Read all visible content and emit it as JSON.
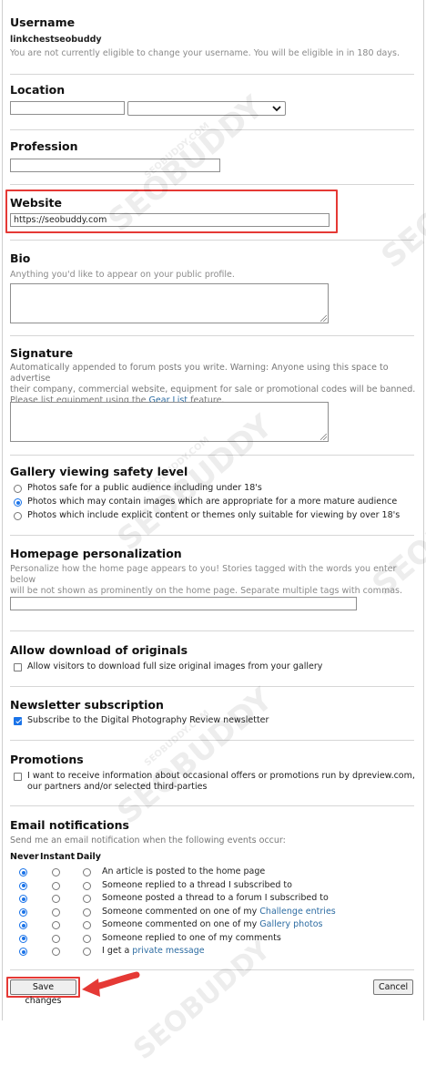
{
  "username": {
    "heading": "Username",
    "value": "linkchestseobuddy",
    "note": "You are not currently eligible to change your username. You will be eligible in in 180 days."
  },
  "location": {
    "heading": "Location",
    "text_value": "",
    "select_value": ""
  },
  "profession": {
    "heading": "Profession",
    "value": ""
  },
  "website": {
    "heading": "Website",
    "value": "https://seobuddy.com"
  },
  "bio": {
    "heading": "Bio",
    "desc": "Anything you'd like to appear on your public profile."
  },
  "signature": {
    "heading": "Signature",
    "desc_line1": "Automatically appended to forum posts you write. Warning: Anyone using this space to advertise",
    "desc_line2": "their company, commercial website, equipment for sale or promotional codes will be banned.",
    "desc_line3_pre": "Please list equipment using the ",
    "desc_link": "Gear List",
    "desc_line3_post": " feature."
  },
  "gallery": {
    "heading": "Gallery viewing safety level",
    "options": [
      {
        "label": "Photos safe for a public audience including under 18's",
        "selected": false
      },
      {
        "label": "Photos which may contain images which are appropriate for a more mature audience",
        "selected": true
      },
      {
        "label": "Photos which include explicit content or themes only suitable for viewing by over 18's",
        "selected": false
      }
    ]
  },
  "homepage": {
    "heading": "Homepage personalization",
    "desc_line1": "Personalize how the home page appears to you! Stories tagged with the words you enter below",
    "desc_line2": "will be not shown as prominently on the home page. Separate multiple tags with commas.",
    "value": ""
  },
  "originals": {
    "heading": "Allow download of originals",
    "label": "Allow visitors to download full size original images from your gallery",
    "checked": false
  },
  "newsletter": {
    "heading": "Newsletter subscription",
    "label": "Subscribe to the Digital Photography Review newsletter",
    "checked": true
  },
  "promotions": {
    "heading": "Promotions",
    "label_line1": "I want to receive information about occasional offers or promotions run by dpreview.com,",
    "label_line2": "our partners and/or selected third-parties",
    "checked": false
  },
  "email": {
    "heading": "Email notifications",
    "desc": "Send me an email notification when the following events occur:",
    "columns": [
      "Never",
      "Instant",
      "Daily"
    ],
    "events": [
      {
        "text": "An article is posted to the home page",
        "link": "",
        "selected": "Never"
      },
      {
        "text": "Someone replied to a thread I subscribed to",
        "link": "",
        "selected": "Never"
      },
      {
        "text": "Someone posted a thread to a forum I subscribed to",
        "link": "",
        "selected": "Never"
      },
      {
        "text": "Someone commented on one of my ",
        "link": "Challenge entries",
        "selected": "Never"
      },
      {
        "text": "Someone commented on one of my ",
        "link": "Gallery photos",
        "selected": "Never"
      },
      {
        "text": "Someone replied to one of my comments",
        "link": "",
        "selected": "Never"
      },
      {
        "text": "I get a ",
        "link": "private message",
        "selected": "Never"
      }
    ]
  },
  "buttons": {
    "save": "Save changes",
    "cancel": "Cancel"
  },
  "watermark": "SEOBUDDY",
  "watermark_small": "SEOBUDDY.COM",
  "colors": {
    "highlight": "#e53935",
    "link": "#2d6ca2",
    "accent": "#1a73e8"
  }
}
